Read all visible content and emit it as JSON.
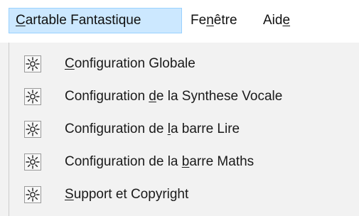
{
  "menubar": {
    "items": [
      {
        "pre": "",
        "key": "C",
        "post": "artable Fantastique",
        "active": true
      },
      {
        "pre": "Fe",
        "key": "n",
        "post": "être",
        "active": false
      },
      {
        "pre": "Aid",
        "key": "e",
        "post": "",
        "active": false
      }
    ]
  },
  "dropdown": {
    "items": [
      {
        "pre": "",
        "key": "C",
        "post": "onfiguration Globale",
        "icon": "sun-gear-icon"
      },
      {
        "pre": "Configuration ",
        "key": "d",
        "post": "e la Synthese Vocale",
        "icon": "sun-gear-icon"
      },
      {
        "pre": "Configuration de ",
        "key": "l",
        "post": "a barre Lire",
        "icon": "sun-gear-icon"
      },
      {
        "pre": "Configuration de la ",
        "key": "b",
        "post": "arre Maths",
        "icon": "sun-gear-icon"
      },
      {
        "pre": "",
        "key": "S",
        "post": "upport et Copyright",
        "icon": "sun-gear-icon"
      }
    ]
  },
  "colors": {
    "menubar_bg": "#ffffff",
    "menu_bg": "#f2f2f2",
    "active_bg": "#cce8ff",
    "active_border": "#99d1ff",
    "text": "#1a1a1a"
  }
}
